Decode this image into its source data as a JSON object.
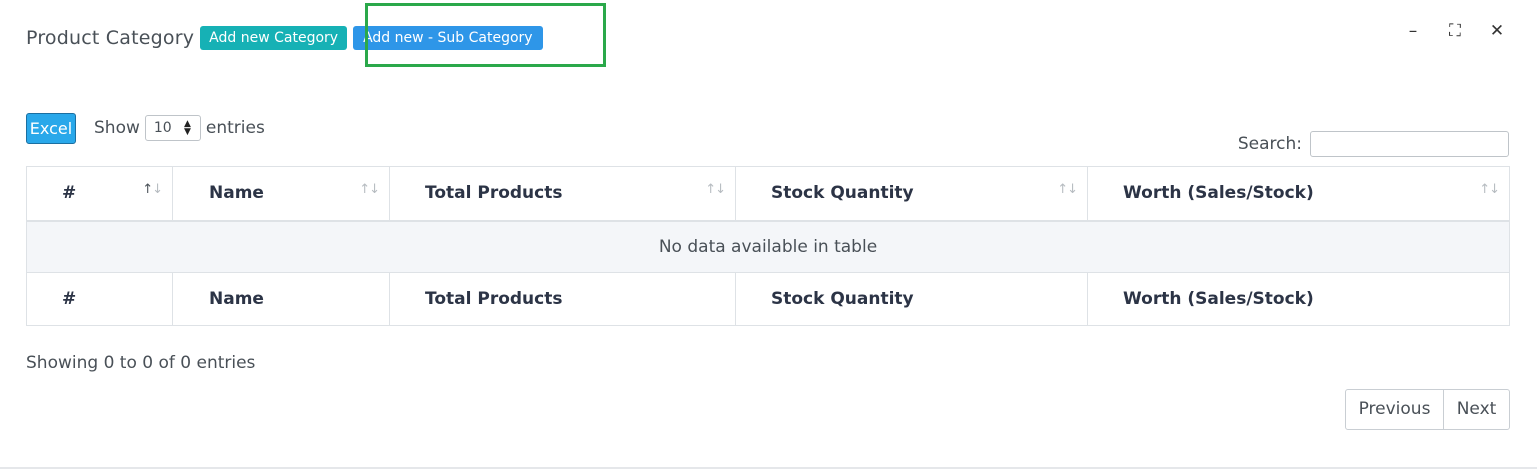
{
  "header": {
    "title": "Product Category",
    "add_category_label": "Add new Category",
    "add_subcategory_label": "Add new - Sub Category"
  },
  "window_controls": {
    "minimize_glyph": "–",
    "maximize_glyph": "⛶",
    "close_glyph": "✕"
  },
  "toolbar": {
    "excel_label": "Excel",
    "show_label": "Show",
    "entries_value": "10",
    "entries_label": "entries",
    "search_label": "Search:",
    "search_value": ""
  },
  "table": {
    "columns": [
      "#",
      "Name",
      "Total Products",
      "Stock Quantity",
      "Worth (Sales/Stock)"
    ],
    "empty_message": "No data available in table",
    "footer_columns": [
      "#",
      "Name",
      "Total Products",
      "Stock Quantity",
      "Worth (Sales/Stock)"
    ]
  },
  "footer": {
    "info": "Showing 0 to 0 of 0 entries",
    "previous_label": "Previous",
    "next_label": "Next"
  },
  "colors": {
    "add_category_bg": "#16b1b5",
    "add_subcategory_bg": "#2e96e8",
    "excel_bg": "#29a8ea",
    "highlight_border": "#2aa84a"
  },
  "icons": {
    "sort": "sort-arrows-icon",
    "minimize": "minimize-icon",
    "maximize": "maximize-icon",
    "close": "close-icon"
  }
}
